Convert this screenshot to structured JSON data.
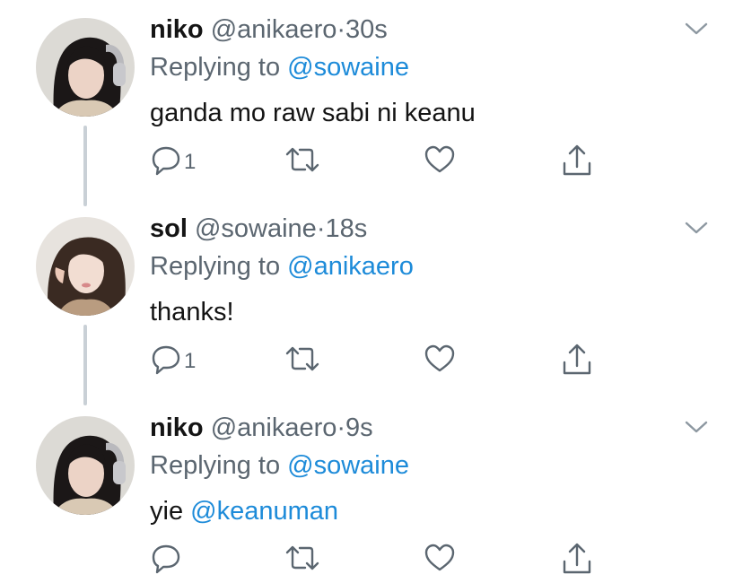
{
  "colors": {
    "text": "#141414",
    "muted": "#5b6670",
    "link": "#1d8bd9",
    "icon": "#5b6670",
    "thread_line": "#c9d0d6"
  },
  "tweets": [
    {
      "name": "niko",
      "handle": "@anikaero",
      "separator": "·",
      "time": "30s",
      "replying_prefix": "Replying to",
      "replying_to": "@sowaine",
      "text": "ganda mo raw sabi ni keanu",
      "text_mention": "",
      "reply_count": "1",
      "icons": [
        "reply-icon",
        "retweet-icon",
        "like-icon",
        "share-icon",
        "chevron-down-icon"
      ]
    },
    {
      "name": "sol",
      "handle": "@sowaine",
      "separator": "·",
      "time": "18s",
      "replying_prefix": "Replying to",
      "replying_to": "@anikaero",
      "text": "thanks!",
      "text_mention": "",
      "reply_count": "1",
      "icons": [
        "reply-icon",
        "retweet-icon",
        "like-icon",
        "share-icon",
        "chevron-down-icon"
      ]
    },
    {
      "name": "niko",
      "handle": "@anikaero",
      "separator": "·",
      "time": "9s",
      "replying_prefix": "Replying to",
      "replying_to": "@sowaine",
      "text": "yie ",
      "text_mention": "@keanuman",
      "reply_count": "",
      "icons": [
        "reply-icon",
        "retweet-icon",
        "like-icon",
        "share-icon",
        "chevron-down-icon"
      ]
    }
  ]
}
